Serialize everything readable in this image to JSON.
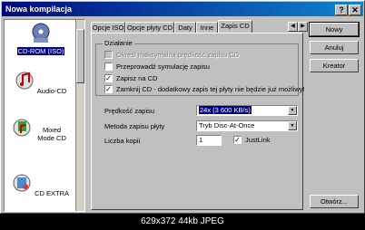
{
  "window": {
    "title": "Nowa kompilacja"
  },
  "titlebar_buttons": {
    "help": "?",
    "close": "✕"
  },
  "left_panel": {
    "items": [
      {
        "label": "CD-ROM (ISO)",
        "selected": true
      },
      {
        "label": "Audio-CD"
      },
      {
        "label": "Mixed Mode CD"
      },
      {
        "label": "CD EXTRA"
      }
    ]
  },
  "tabs": [
    "Opcje ISO",
    "Opcje płyty CD",
    "Daty",
    "Inne",
    "Zapis CD"
  ],
  "active_tab": "Zapis CD",
  "action_group": {
    "label": "Działanie",
    "options": [
      {
        "label": "Określ maksymalną prędkość zapisu CD",
        "checked": false,
        "enabled": false
      },
      {
        "label": "Przeprowadź symulację zapisu",
        "checked": false,
        "enabled": true
      },
      {
        "label": "Zapisz na CD",
        "checked": true,
        "enabled": true
      },
      {
        "label": "Zamknij CD - dodatkowy zapis tej płyty nie będzie już możliwy!",
        "checked": true,
        "enabled": true
      }
    ]
  },
  "fields": {
    "speed_label": "Prędkość zapisu",
    "speed_value": "24x (3 600 KB/s)",
    "method_label": "Metoda zapisu płyty",
    "method_value": "Tryb Disc-At-Once",
    "copies_label": "Liczba kopii",
    "copies_value": "1",
    "justlink_label": "JustLink",
    "justlink_checked": true
  },
  "buttons": {
    "new": "Nowy",
    "cancel": "Anuluj",
    "wizard": "Kreator",
    "open": "Otwórz..."
  },
  "caption": "629x372 44kb JPEG"
}
